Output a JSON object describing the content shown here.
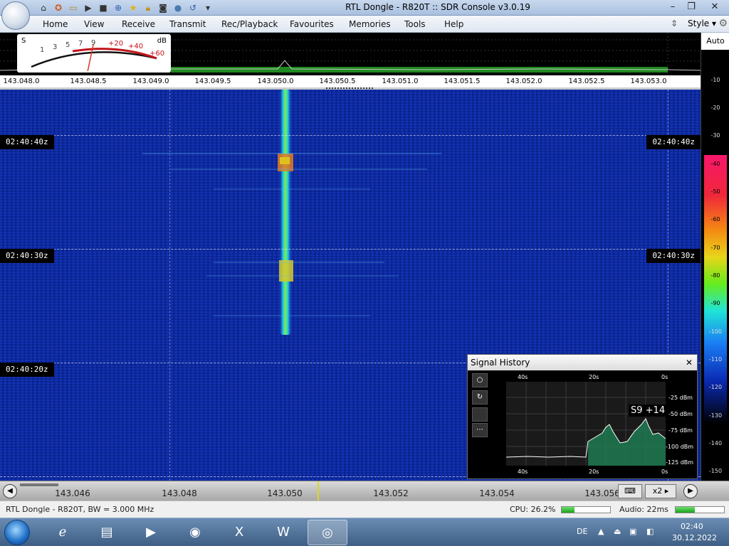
{
  "window": {
    "title": "RTL Dongle - R820T :: SDR Console v3.0.19",
    "controls": [
      "minimize-icon",
      "maximize-icon",
      "close-icon"
    ]
  },
  "quick_access_icons": [
    "home-icon",
    "options-icon",
    "folder-icon",
    "play-icon",
    "stop-icon",
    "add-icon",
    "favourite-icon",
    "lock-icon",
    "camera-icon",
    "drop-icon",
    "undo-icon",
    "dropdown-icon"
  ],
  "menu": {
    "items": [
      "Home",
      "View",
      "Receive",
      "Transmit",
      "Rec/Playback",
      "Favourites",
      "Memories",
      "Tools",
      "Help"
    ],
    "style_label": "Style"
  },
  "smeter": {
    "s_label": "S",
    "db_label": "dB",
    "s_scale": [
      "1",
      "3",
      "5",
      "7",
      "9"
    ],
    "db_scale": [
      "+20",
      "+40",
      "+60"
    ],
    "reading_fraction": 0.45
  },
  "freq_axis": {
    "labels": [
      "143.048.0",
      "143.048.5",
      "143.049.0",
      "143.049.5",
      "143.050.0",
      "143.050.5",
      "143.051.0",
      "143.051.5",
      "143.052.0",
      "143.052.5",
      "143.053.0"
    ]
  },
  "waterfall": {
    "timestamps": [
      {
        "left": "02:40:40z",
        "right": "02:40:40z"
      },
      {
        "left": "02:40:30z",
        "right": "02:40:30z"
      },
      {
        "left": "02:40:20z",
        "right": ""
      }
    ]
  },
  "right_scale": {
    "auto_label": "Auto",
    "ticks": [
      "-10",
      "-20",
      "-30",
      "-40",
      "-50",
      "-60",
      "-70",
      "-80",
      "-90",
      "-100",
      "-110",
      "-120",
      "-130",
      "-140",
      "-150"
    ]
  },
  "signal_history": {
    "title": "Signal History",
    "time_top": [
      "40s",
      "20s",
      "0s"
    ],
    "time_bottom": [
      "40s",
      "20s",
      "0s"
    ],
    "dbm_labels": [
      "-25 dBm",
      "-50 dBm",
      "-75 dBm",
      "-100 dBm",
      "-125 dBm"
    ],
    "reading": "S9 +14",
    "tools": [
      "circle-icon",
      "refresh-icon",
      "blank",
      "more-icon"
    ]
  },
  "bottom_bar": {
    "freqs": [
      "143.046",
      "143.048",
      "143.050",
      "143.052",
      "143.054",
      "143.056"
    ],
    "zoom": "x2"
  },
  "status": {
    "device": "RTL Dongle - R820T, BW = 3.000 MHz",
    "cpu": "CPU: 26.2%",
    "cpu_fraction": 0.262,
    "audio": "Audio: 22ms",
    "audio_fraction": 0.4
  },
  "taskbar": {
    "apps": [
      "ie-icon",
      "explorer-icon",
      "media-player-icon",
      "chrome-icon",
      "excel-icon",
      "word-icon",
      "sdr-console-icon"
    ],
    "language": "DE",
    "time": "02:40",
    "date": "30.12.2022"
  }
}
